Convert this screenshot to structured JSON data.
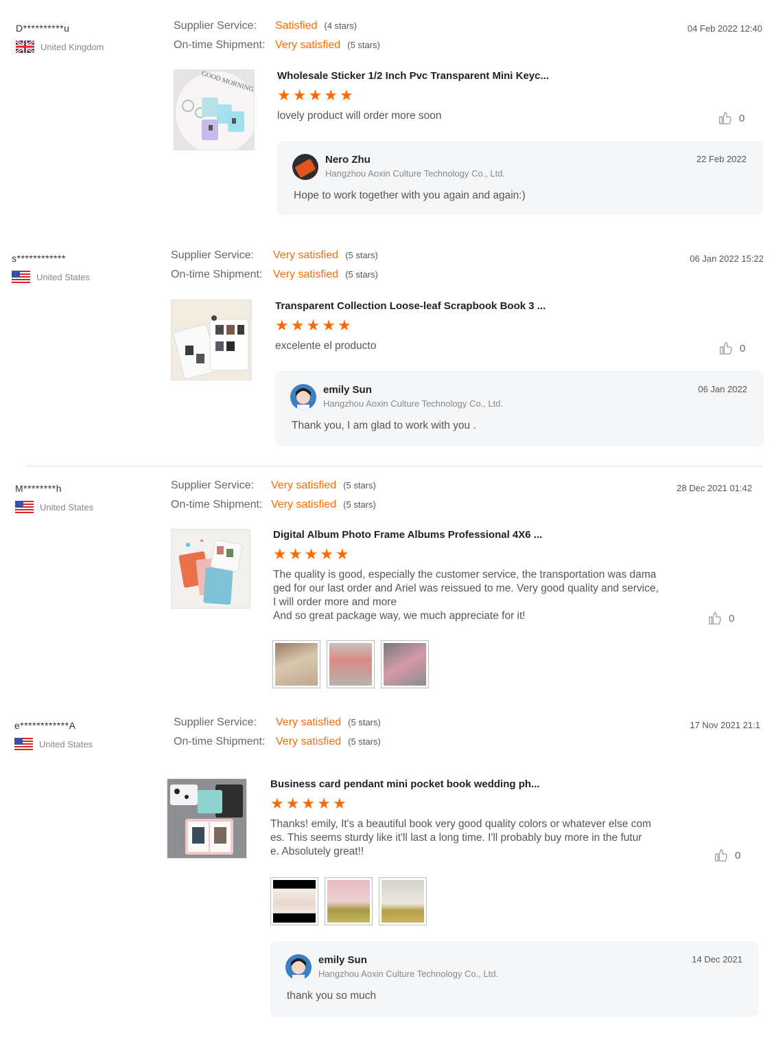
{
  "common": {
    "supplier_service_label": "Supplier Service:",
    "ontime_shipment_label": "On-time Shipment:",
    "supplier_company": "Hangzhou Aoxin Culture Technology Co., Ltd."
  },
  "colors": {
    "accent": "#ff6a00",
    "reply_bg": "#f5f6f7"
  },
  "reviews": [
    {
      "user": "D**********u",
      "country": "United Kingdom",
      "flag": "uk-flag-icon",
      "date": "04 Feb 2022 12:40",
      "supplier_service": {
        "value": "Satisfied",
        "stars": "(4 stars)"
      },
      "ontime_shipment": {
        "value": "Very satisfied",
        "stars": "(5 stars)"
      },
      "product_title": "Wholesale Sticker 1/2 Inch Pvc Transparent Mini Keyc...",
      "product_image_text": "GOOD MORNING",
      "rating": 5,
      "comment": [
        "lovely product will order more soon"
      ],
      "likes": "0",
      "reply": {
        "name": "Nero Zhu",
        "date": "22 Feb 2022",
        "text": "Hope to work together with you again and again:)"
      }
    },
    {
      "user": "s************",
      "country": "United States",
      "flag": "us-flag-icon",
      "date": "06 Jan 2022 15:22",
      "supplier_service": {
        "value": "Very satisfied",
        "stars": "(5 stars)"
      },
      "ontime_shipment": {
        "value": "Very satisfied",
        "stars": "(5 stars)"
      },
      "product_title": "Transparent Collection Loose-leaf Scrapbook Book 3 ...",
      "rating": 5,
      "comment": [
        "excelente el producto"
      ],
      "likes": "0",
      "reply": {
        "name": "emily Sun",
        "date": "06 Jan 2022",
        "text": "Thank you, I am glad to work with you ."
      }
    },
    {
      "user": "M********h",
      "country": "United States",
      "flag": "us-flag-icon",
      "date": "28 Dec 2021 01:42",
      "supplier_service": {
        "value": "Very satisfied",
        "stars": "(5 stars)"
      },
      "ontime_shipment": {
        "value": "Very satisfied",
        "stars": "(5 stars)"
      },
      "product_title": "Digital Album Photo Frame Albums Professional 4X6 ...",
      "rating": 5,
      "comment": [
        "The quality is good, especially the customer service, the transportation was dama",
        "ged for our last order and Ariel was reissued to me. Very good quality and service,",
        "I will order more and more",
        "And so great package way, we much appreciate for it!"
      ],
      "likes": "0"
    },
    {
      "user": "e************A",
      "country": "United States",
      "flag": "us-flag-icon",
      "date": "17 Nov 2021 21:1",
      "supplier_service": {
        "value": "Very satisfied",
        "stars": "(5 stars)"
      },
      "ontime_shipment": {
        "value": "Very satisfied",
        "stars": "(5 stars)"
      },
      "product_title": "Business card pendant mini pocket book wedding ph...",
      "rating": 5,
      "comment": [
        "Thanks! emily, It's a beautiful book very good quality  colors or whatever else com",
        "es. This seems sturdy like it'll last a long time. I'll probably buy more in the futur",
        "e. Absolutely great!!"
      ],
      "likes": "0",
      "reply": {
        "name": "emily Sun",
        "date": "14 Dec 2021",
        "text": "thank you so much"
      }
    }
  ]
}
